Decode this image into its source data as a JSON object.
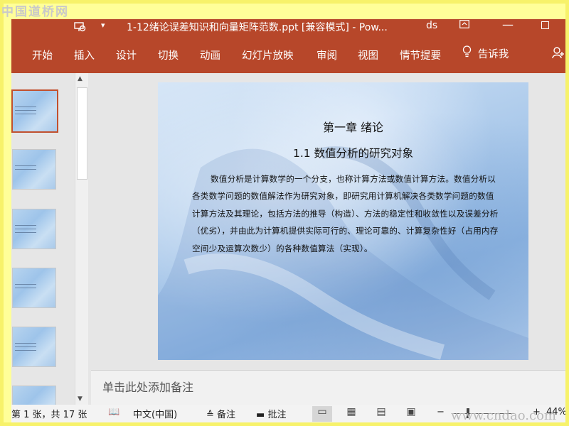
{
  "watermark": {
    "top_text": "中国道桥网",
    "bottom_text": "www.cndao.com"
  },
  "titlebar": {
    "doc_title": "1-12绪论误差知识和向量矩阵范数.ppt [兼容模式]  -  Pow...",
    "user": "ds",
    "qa_icon": "slideshow-icon",
    "qa_dropdown_glyph": "▾",
    "ribbon_options_glyph": "⊡",
    "minimize_glyph": "—"
  },
  "tabs": {
    "items": [
      "开始",
      "插入",
      "设计",
      "切换",
      "动画",
      "幻灯片放映",
      "审阅",
      "视图",
      "情节提要"
    ],
    "tell_me": "告诉我",
    "tell_me_icon": "lightbulb-icon",
    "bulb_glyph": "💡",
    "share_glyph": "⚇"
  },
  "scrollbar": {
    "up": "▲",
    "down": "▼"
  },
  "slide": {
    "heading": "第一章  绪论",
    "subheading": "1.1  数值分析的研究对象",
    "body": "数值分析是计算数学的一个分支，也称计算方法或数值计算方法。数值分析以各类数学问题的数值解法作为研究对象，即研究用计算机解决各类数学问题的数值计算方法及其理论，包括方法的推导（构造）、方法的稳定性和收敛性以及误差分析（优劣），并由此为计算机提供实际可行的、理论可靠的、计算复杂性好（占用内存空间少及运算次数少）的各种数值算法（实现）。"
  },
  "notes": {
    "placeholder": "单击此处添加备注"
  },
  "statusbar": {
    "slide_pos": "第 1 张，共 17 张",
    "language": "中文(中国)",
    "notes_label": "备注",
    "comments_label": "批注",
    "zoom": "44%",
    "notes_icon": "notes-icon",
    "comments_icon": "comment-icon",
    "spell_glyph": "📖",
    "notes_glyph": "≙",
    "comments_glyph": "▬",
    "view_normal_glyph": "▭",
    "view_sorter_glyph": "▦",
    "view_reading_glyph": "▤",
    "view_show_glyph": "▣",
    "zoom_out_glyph": "−",
    "zoom_in_glyph": "+"
  },
  "colors": {
    "ribbon": "#b7472a",
    "selected_thumb_border": "#c1502e",
    "frame": "#f7f26a"
  }
}
